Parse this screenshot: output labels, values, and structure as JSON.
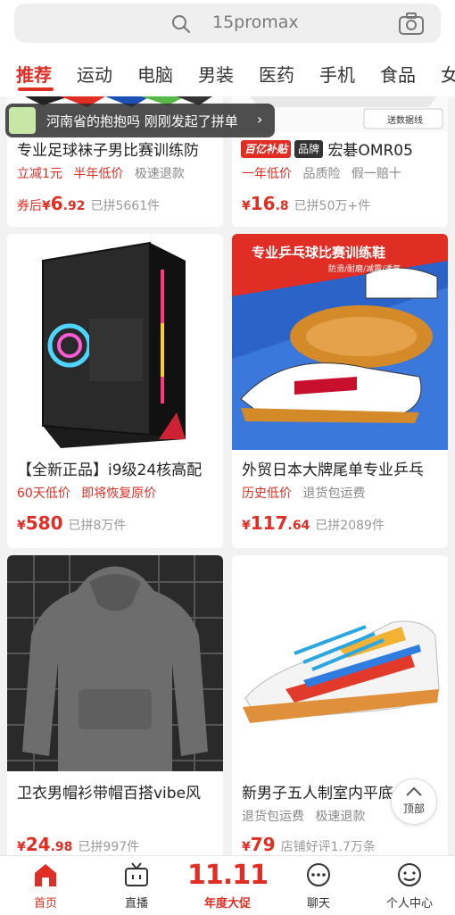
{
  "search": {
    "placeholder": "15promax"
  },
  "tabs": [
    "推荐",
    "运动",
    "电脑",
    "男装",
    "医药",
    "手机",
    "食品",
    "女"
  ],
  "toast": {
    "text": "河南省的抱抱吗 刚刚发起了拼单"
  },
  "products": [
    {
      "title": "专业足球袜子男比赛训练防",
      "tags": [
        [
          "立减1元",
          "red"
        ],
        [
          "半年低价",
          "red"
        ],
        [
          "极速退款",
          "gray"
        ]
      ],
      "price_prefix": "券后",
      "price_int": "6",
      "price_dec": ".92",
      "sold": "已拼5661件",
      "img_label": ""
    },
    {
      "title": "宏碁OMR05",
      "badge1": "百亿补贴",
      "badge2": "品牌",
      "tags": [
        [
          "一年低价",
          "red"
        ],
        [
          "品质险",
          "gray"
        ],
        [
          "假一赔十",
          "gray"
        ]
      ],
      "price_prefix": "",
      "price_int": "16",
      "price_dec": ".8",
      "sold": "已拼50万+件",
      "img_label": "送数据线"
    },
    {
      "title": "【全新正品】i9级24核高配",
      "tags": [
        [
          "60天低价",
          "red"
        ],
        [
          "即将恢复原价",
          "red"
        ]
      ],
      "price_prefix": "",
      "price_int": "580",
      "price_dec": "",
      "sold": "已拼8万件"
    },
    {
      "title": "外贸日本大牌尾单专业乒乓",
      "tags": [
        [
          "历史低价",
          "red"
        ],
        [
          "退货包运费",
          "gray"
        ]
      ],
      "price_prefix": "",
      "price_int": "117",
      "price_dec": ".64",
      "sold": "已拼2089件",
      "img_title": "专业乒乓球比赛训练鞋",
      "img_sub": "防滑/耐磨/减震/透气"
    },
    {
      "title": "卫衣男帽衫带帽百搭vibe风",
      "tags": [],
      "price_prefix": "",
      "price_int": "24",
      "price_dec": ".98",
      "sold": "已拼997件"
    },
    {
      "title": "新男子五人制室内平底",
      "tags": [
        [
          "退货包运费",
          "gray"
        ],
        [
          "极速退款",
          "gray"
        ]
      ],
      "price_prefix": "",
      "price_int": "79",
      "price_dec": "",
      "sold": "店铺好评1.7万条"
    }
  ],
  "backtop": "顶部",
  "bottom_nav": {
    "home": "首页",
    "live": "直播",
    "promo_big": "11.11",
    "promo": "年度大促",
    "chat": "聊天",
    "me": "个人中心"
  },
  "colors": {
    "accent": "#e02e24"
  }
}
